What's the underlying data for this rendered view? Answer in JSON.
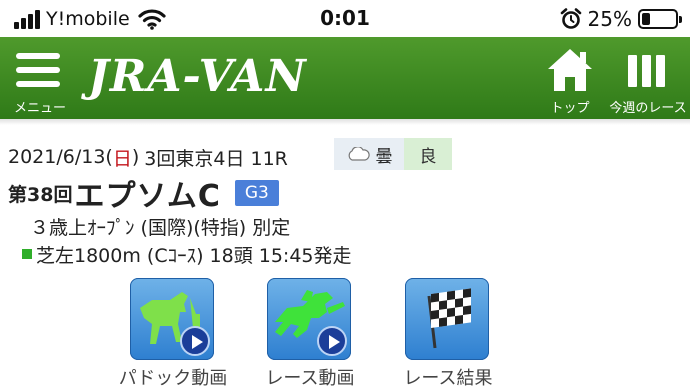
{
  "status_bar": {
    "carrier": "Y!mobile",
    "time": "0:01",
    "battery_percent": "25%",
    "battery_level": 0.25,
    "icons": [
      "signal-icon",
      "wifi-icon",
      "alarm-icon",
      "battery-icon"
    ]
  },
  "header": {
    "menu_label": "メニュー",
    "logo": "JRA-VAN",
    "top_label": "トップ",
    "week_label": "今週のレース",
    "background": "#3a8a1f"
  },
  "race": {
    "date": "2021/6/13(",
    "day": "日",
    "date_close": ")",
    "meeting": "3回東京4日 11R",
    "weather": "曇",
    "going": "良",
    "race_number": "第38回",
    "race_name": "エプソムC",
    "grade": "G3",
    "conditions": "３歳上ｵｰﾌﾟﾝ (国際)(特指) 別定",
    "course": "芝左1800m (Cｺｰｽ) 18頭 15:45発走"
  },
  "media": [
    {
      "label": "パドック動画",
      "icon": "paddock-video-icon"
    },
    {
      "label": "レース動画",
      "icon": "race-video-icon"
    },
    {
      "label": "レース結果",
      "icon": "race-result-icon"
    }
  ],
  "colors": {
    "header_green": "#3a8a1f",
    "grade_blue": "#4a7fd9",
    "sunday_red": "#c4161c",
    "going_bg": "#d9efd4",
    "weather_bg": "#e8eef4"
  }
}
